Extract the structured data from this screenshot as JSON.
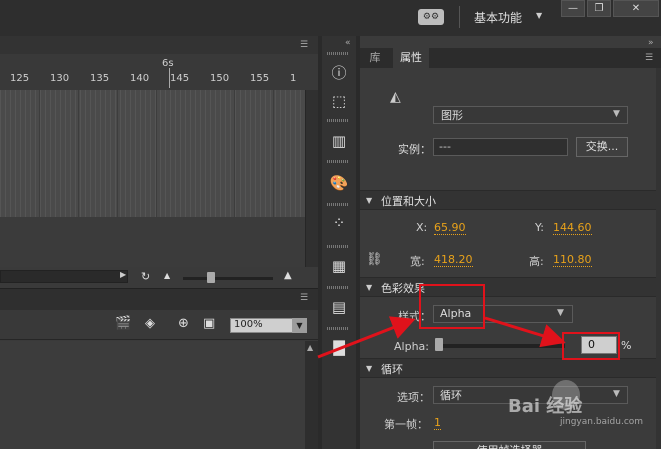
{
  "topbar": {
    "workspace_label": "基本功能",
    "workspace_icon": "workspace-switcher-icon",
    "window_buttons": [
      "minimize",
      "maximize",
      "close"
    ]
  },
  "timeline": {
    "seconds_marker": "6s",
    "frame_ticks": [
      "125",
      "130",
      "135",
      "140",
      "145",
      "150",
      "155",
      "1"
    ]
  },
  "stage_toolbar": {
    "zoom_value": "100%"
  },
  "properties": {
    "tabs": [
      {
        "label": "库",
        "active": false
      },
      {
        "label": "属性",
        "active": true
      }
    ],
    "type_value": "图形",
    "instance_label": "实例：",
    "instance_value": "---",
    "swap_button": "交换...",
    "position_size": {
      "title": "位置和大小",
      "x_label": "X:",
      "x_value": "65.90",
      "y_label": "Y:",
      "y_value": "144.60",
      "w_label": "宽:",
      "w_value": "418.20",
      "h_label": "高:",
      "h_value": "110.80"
    },
    "color_effect": {
      "title": "色彩效果",
      "style_label": "样式：",
      "style_value": "Alpha",
      "alpha_label": "Alpha:",
      "alpha_value": "0",
      "alpha_unit": "%"
    },
    "loop": {
      "title": "循环",
      "options_label": "选项：",
      "options_value": "循环",
      "first_frame_label": "第一帧：",
      "first_frame_value": "1",
      "picker_button": "使用帧选择器"
    }
  },
  "watermark": {
    "brand": "Bai 经验",
    "url": "jingyan.baidu.com"
  },
  "colors": {
    "value_orange": "#e8a21a",
    "annotation_red": "#e0121b",
    "panel_bg": "#3b3b3b"
  }
}
